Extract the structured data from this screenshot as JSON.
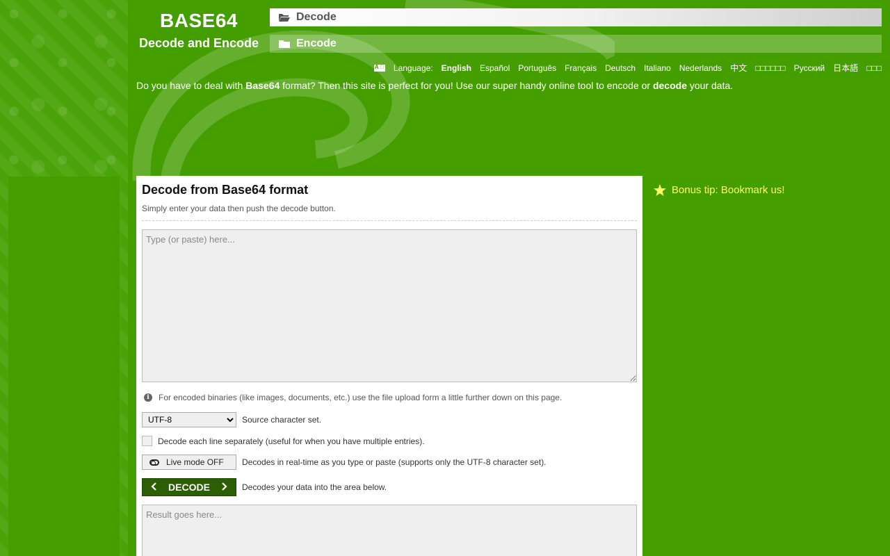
{
  "brand": {
    "title": "BASE64",
    "subtitle": "Decode and Encode"
  },
  "nav": {
    "decode_label": "Decode",
    "encode_label": "Encode"
  },
  "language": {
    "label": "Language:",
    "items": [
      "English",
      "Español",
      "Português",
      "Français",
      "Deutsch",
      "Italiano",
      "Nederlands",
      "中文",
      "□□□□□□",
      "Русский",
      "日本語",
      "□□□"
    ],
    "active": "English"
  },
  "intro": {
    "part1": "Do you have to deal with ",
    "bold1": "Base64",
    "part2": " format? Then this site is perfect for you! Use our super handy online tool to encode or ",
    "bold2": "decode",
    "part3": " your data."
  },
  "panel": {
    "title": "Decode from Base64 format",
    "subtitle": "Simply enter your data then push the decode button.",
    "input_placeholder": "Type (or paste) here...",
    "binary_note": "For encoded binaries (like images, documents, etc.) use the file upload form a little further down on this page.",
    "charset_value": "UTF-8",
    "charset_label": "Source character set.",
    "each_line_label": "Decode each line separately (useful for when you have multiple entries).",
    "live_mode_label": "Live mode OFF",
    "live_mode_desc": "Decodes in real-time as you type or paste (supports only the UTF-8 character set).",
    "decode_button": "DECODE",
    "decode_desc": "Decodes your data into the area below.",
    "result_placeholder": "Result goes here..."
  },
  "tip": {
    "text": "Bonus tip: Bookmark us!"
  },
  "colors": {
    "background": "#459e00",
    "accent_dark": "#2c5e05",
    "tip": "#ffff66"
  }
}
